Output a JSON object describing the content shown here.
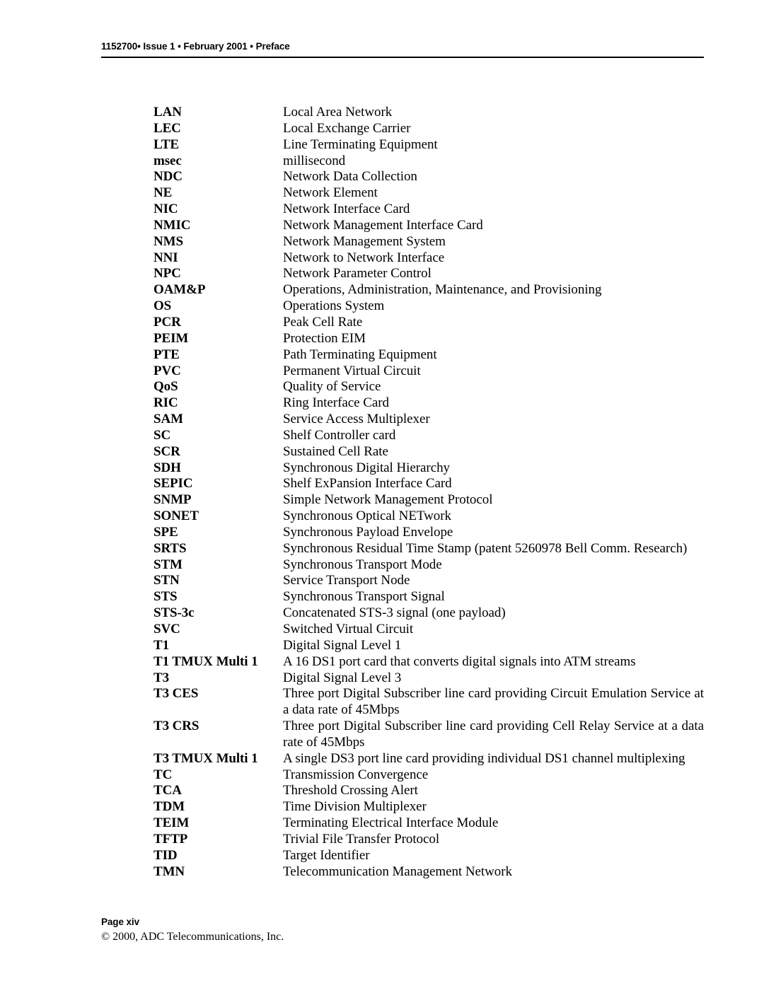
{
  "header": {
    "text": "1152700• Issue 1 • February 2001 • Preface"
  },
  "glossary": {
    "entries": [
      {
        "term": "LAN",
        "definition": "Local Area Network",
        "justify": false
      },
      {
        "term": "LEC",
        "definition": "Local Exchange Carrier",
        "justify": false
      },
      {
        "term": "LTE",
        "definition": "Line Terminating Equipment",
        "justify": false
      },
      {
        "term": "msec",
        "definition": "millisecond",
        "justify": false
      },
      {
        "term": "NDC",
        "definition": "Network Data Collection",
        "justify": false
      },
      {
        "term": "NE",
        "definition": "Network Element",
        "justify": false
      },
      {
        "term": "NIC",
        "definition": "Network Interface Card",
        "justify": false
      },
      {
        "term": "NMIC",
        "definition": "Network Management Interface Card",
        "justify": false
      },
      {
        "term": "NMS",
        "definition": "Network Management System",
        "justify": false
      },
      {
        "term": "NNI",
        "definition": "Network to Network Interface",
        "justify": false
      },
      {
        "term": "NPC",
        "definition": "Network Parameter Control",
        "justify": false
      },
      {
        "term": "OAM&P",
        "definition": "Operations, Administration, Maintenance, and Provisioning",
        "justify": false
      },
      {
        "term": "OS",
        "definition": "Operations System",
        "justify": false
      },
      {
        "term": "PCR",
        "definition": "Peak Cell Rate",
        "justify": false
      },
      {
        "term": "PEIM",
        "definition": "Protection EIM",
        "justify": false
      },
      {
        "term": "PTE",
        "definition": "Path Terminating Equipment",
        "justify": false
      },
      {
        "term": "PVC",
        "definition": "Permanent Virtual Circuit",
        "justify": false
      },
      {
        "term": "QoS",
        "definition": "Quality of Service",
        "justify": false
      },
      {
        "term": "RIC",
        "definition": "Ring Interface Card",
        "justify": false
      },
      {
        "term": "SAM",
        "definition": "Service Access Multiplexer",
        "justify": false
      },
      {
        "term": "SC",
        "definition": "Shelf Controller card",
        "justify": false
      },
      {
        "term": "SCR",
        "definition": "Sustained Cell Rate",
        "justify": false
      },
      {
        "term": "SDH",
        "definition": "Synchronous Digital Hierarchy",
        "justify": false
      },
      {
        "term": "SEPIC",
        "definition": "Shelf ExPansion Interface Card",
        "justify": false
      },
      {
        "term": "SNMP",
        "definition": "Simple Network Management Protocol",
        "justify": false
      },
      {
        "term": "SONET",
        "definition": "Synchronous Optical NETwork",
        "justify": false
      },
      {
        "term": "SPE",
        "definition": "Synchronous Payload Envelope",
        "justify": false
      },
      {
        "term": "SRTS",
        "definition": "Synchronous Residual Time Stamp (patent 5260978 Bell Comm. Research)",
        "justify": false
      },
      {
        "term": "STM",
        "definition": "Synchronous Transport Mode",
        "justify": false
      },
      {
        "term": "STN",
        "definition": "Service Transport Node",
        "justify": false
      },
      {
        "term": "STS",
        "definition": "Synchronous Transport Signal",
        "justify": false
      },
      {
        "term": "STS-3c",
        "definition": "Concatenated STS-3 signal (one payload)",
        "justify": false
      },
      {
        "term": "SVC",
        "definition": "Switched Virtual Circuit",
        "justify": false
      },
      {
        "term": "T1",
        "definition": "Digital Signal Level 1",
        "justify": false
      },
      {
        "term": "T1 TMUX Multi 1",
        "definition": "A 16 DS1 port card that converts digital signals into ATM streams",
        "justify": false
      },
      {
        "term": "T3",
        "definition": "Digital Signal Level 3",
        "justify": false
      },
      {
        "term": "T3 CES",
        "definition": "Three port Digital Subscriber line card providing Circuit Emulation Service at a data rate of 45Mbps",
        "justify": true
      },
      {
        "term": "T3 CRS",
        "definition": "Three port Digital Subscriber line card providing Cell Relay Service at a data rate of 45Mbps",
        "justify": true
      },
      {
        "term": "T3 TMUX Multi 1",
        "definition": "A single DS3 port line card providing individual DS1 channel multiplexing",
        "justify": false
      },
      {
        "term": "TC",
        "definition": "Transmission Convergence",
        "justify": false
      },
      {
        "term": "TCA",
        "definition": "Threshold Crossing Alert",
        "justify": false
      },
      {
        "term": "TDM",
        "definition": "Time Division Multiplexer",
        "justify": false
      },
      {
        "term": "TEIM",
        "definition": "Terminating Electrical Interface Module",
        "justify": false
      },
      {
        "term": "TFTP",
        "definition": "Trivial File Transfer Protocol",
        "justify": false
      },
      {
        "term": "TID",
        "definition": "Target Identifier",
        "justify": false
      },
      {
        "term": "TMN",
        "definition": "Telecommunication Management Network",
        "justify": false
      }
    ]
  },
  "footer": {
    "page_label": "Page xiv",
    "copyright": "© 2000, ADC Telecommunications, Inc."
  }
}
